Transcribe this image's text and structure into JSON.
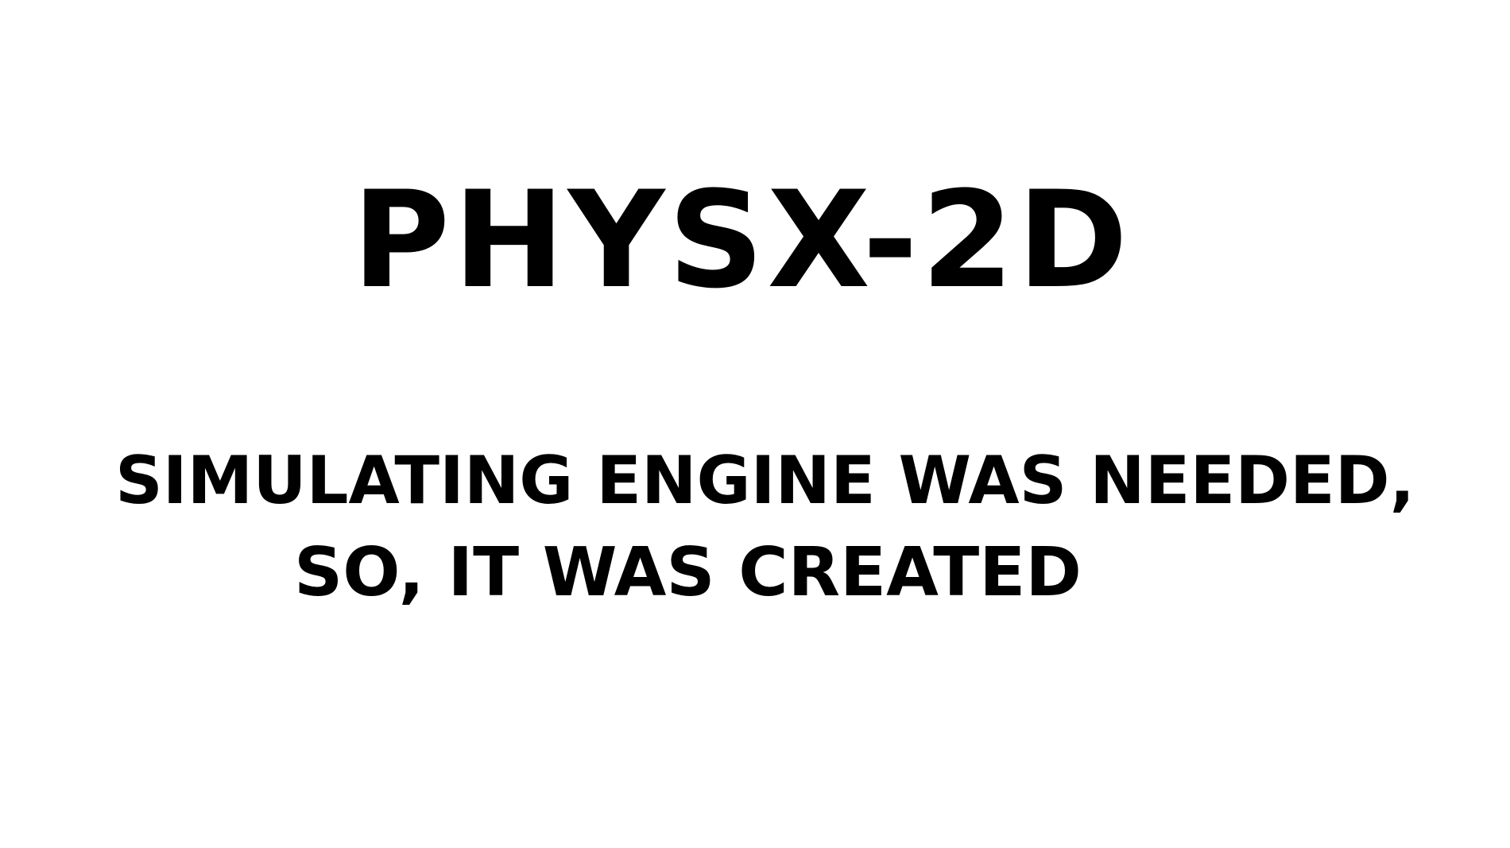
{
  "slide": {
    "title": "PHYSX-2D",
    "caption_line_1": "SIMULATING ENGINE WAS NEEDED,",
    "caption_line_2": "SO, IT WAS CREATED"
  },
  "colors": {
    "background": "#ffffff",
    "text": "#000000"
  }
}
